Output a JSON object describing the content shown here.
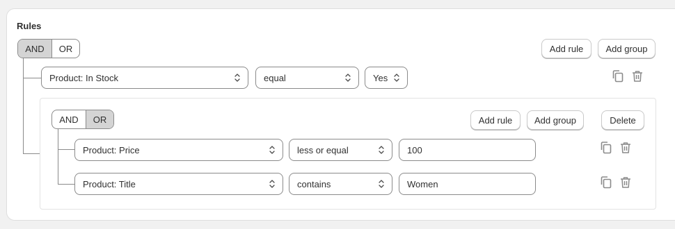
{
  "title": "Rules",
  "root": {
    "combinator": {
      "and_label": "AND",
      "or_label": "OR",
      "active": "AND"
    },
    "add_rule_label": "Add rule",
    "add_group_label": "Add group",
    "rule": {
      "field": "Product: In Stock",
      "operator": "equal",
      "value": "Yes"
    }
  },
  "group": {
    "combinator": {
      "and_label": "AND",
      "or_label": "OR",
      "active": "OR"
    },
    "add_rule_label": "Add rule",
    "add_group_label": "Add group",
    "delete_label": "Delete",
    "rules": [
      {
        "field": "Product: Price",
        "operator": "less or equal",
        "value": "100"
      },
      {
        "field": "Product: Title",
        "operator": "contains",
        "value": "Women"
      }
    ]
  },
  "colors": {
    "active_segment": "#d4d4d4",
    "border": "#8a8a8a",
    "icon": "#8a8a8a"
  }
}
